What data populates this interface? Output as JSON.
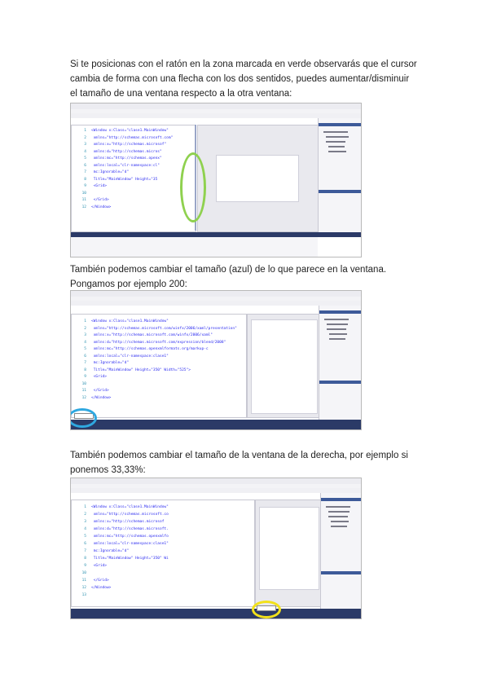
{
  "paragraphs": [
    "Si te posicionas con el ratón en la zona marcada en verde observarás que el cursor cambia de forma con una flecha con los dos sentidos, puedes aumentar/disminuir el tamaño de una ventana respecto a la otra ventana:",
    "También podemos cambiar el tamaño (azul) de lo que parece en la ventana. Pongamos por ejemplo 200:",
    "También podemos cambiar el tamaño de la ventana de la derecha, por ejemplo si ponemos 33,33%:"
  ],
  "screenshot1": {
    "code_lines": [
      {
        "n": "1",
        "text": "<Window x:Class=\"clase1.MainWindow\""
      },
      {
        "n": "2",
        "text": "        xmlns=\"http://schemas.microsoft.com\""
      },
      {
        "n": "3",
        "text": "        xmlns:x=\"http://schemas.microsof\""
      },
      {
        "n": "4",
        "text": "        xmlns:d=\"http://schemas.micros\""
      },
      {
        "n": "5",
        "text": "        xmlns:mc=\"http://schemas.openx\""
      },
      {
        "n": "6",
        "text": "        xmlns:local=\"clr-namespace:cl\""
      },
      {
        "n": "7",
        "text": "        mc:Ignorable=\"d\""
      },
      {
        "n": "8",
        "text": "        Title=\"MainWindow\" Height=\"35"
      },
      {
        "n": "9",
        "text": "    <Grid>"
      },
      {
        "n": "10",
        "text": ""
      },
      {
        "n": "11",
        "text": "    </Grid>"
      },
      {
        "n": "12",
        "text": "</Window>"
      }
    ],
    "highlight_color": "#8fd14f"
  },
  "screenshot2": {
    "code_lines": [
      {
        "n": "1",
        "text": "<Window x:Class=\"clase1.MainWindow\""
      },
      {
        "n": "2",
        "text": "        xmlns=\"http://schemas.microsoft.com/winfx/2006/xaml/presentation\""
      },
      {
        "n": "3",
        "text": "        xmlns:x=\"http://schemas.microsoft.com/winfx/2006/xaml\""
      },
      {
        "n": "4",
        "text": "        xmlns:d=\"http://schemas.microsoft.com/expression/blend/2008\""
      },
      {
        "n": "5",
        "text": "        xmlns:mc=\"http://schemas.openxmlformats.org/markup-c"
      },
      {
        "n": "6",
        "text": "        xmlns:local=\"clr-namespace:clase1\""
      },
      {
        "n": "7",
        "text": "        mc:Ignorable=\"d\""
      },
      {
        "n": "8",
        "text": "        Title=\"MainWindow\" Height=\"350\" Width=\"525\">"
      },
      {
        "n": "9",
        "text": "    <Grid>"
      },
      {
        "n": "10",
        "text": ""
      },
      {
        "n": "11",
        "text": "    </Grid>"
      },
      {
        "n": "12",
        "text": "</Window>"
      }
    ],
    "highlight_color": "#2fa8e0"
  },
  "screenshot3": {
    "code_lines": [
      {
        "n": "1",
        "text": "<Window x:Class=\"clase1.MainWindow\""
      },
      {
        "n": "2",
        "text": "        xmlns=\"http://schemas.microsoft.co"
      },
      {
        "n": "3",
        "text": "        xmlns:x=\"http://schemas.microsof"
      },
      {
        "n": "4",
        "text": "        xmlns:d=\"http://schemas.microsoft."
      },
      {
        "n": "5",
        "text": "        xmlns:mc=\"http://schemas.openxmlfo"
      },
      {
        "n": "6",
        "text": "        xmlns:local=\"clr-namespace:clase1\""
      },
      {
        "n": "7",
        "text": "        mc:Ignorable=\"d\""
      },
      {
        "n": "8",
        "text": "        Title=\"MainWindow\" Height=\"350\" Wi"
      },
      {
        "n": "9",
        "text": "    <Grid>"
      },
      {
        "n": "10",
        "text": ""
      },
      {
        "n": "11",
        "text": "    </Grid>"
      },
      {
        "n": "12",
        "text": "</Window>"
      },
      {
        "n": "13",
        "text": ""
      }
    ],
    "highlight_color": "#f2e11a"
  }
}
